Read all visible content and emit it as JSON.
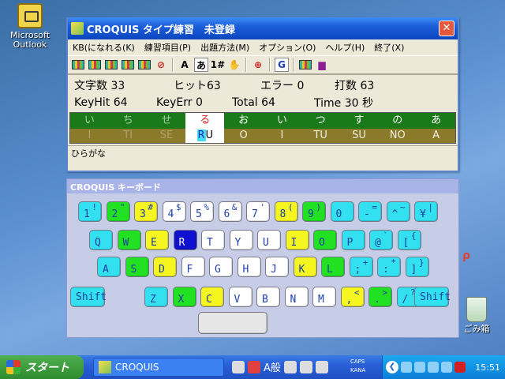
{
  "desktop": {
    "outlook_label": "Microsoft Outlook",
    "recycle_label": "ごみ箱",
    "side_glyph": "ρ"
  },
  "window": {
    "title": "CROQUIS タイプ練習　未登録",
    "close_glyph": "✕",
    "menu": [
      "KB(になれる(K)",
      "練習項目(P)",
      "出題方法(M)",
      "オプション(O)",
      "ヘルプ(H)",
      "終了(X)"
    ],
    "toolbar": {
      "a_label": "A",
      "kana_label": "あ",
      "num_label": "1#",
      "g_label": "G"
    },
    "stats": {
      "chars": "文字数 33",
      "hits": "ヒット63",
      "errors": "エラー 0",
      "strokes": "打数 63",
      "keyhit": "KeyHit 64",
      "keyerr": "KeyErr 0",
      "total": "Total 64",
      "time": "Time 30 秒"
    },
    "lane_kana": [
      "い",
      "ち",
      "せ",
      "る",
      "お",
      "い",
      "つ",
      "す",
      "の",
      "あ"
    ],
    "lane_roman": [
      "I",
      "TI",
      "SE",
      "RU",
      "O",
      "I",
      "TU",
      "SU",
      "NO",
      "A"
    ],
    "lane_cursor": 3,
    "status_text": "ひらがな"
  },
  "keyboard": {
    "title": "CROQUIS キーボード",
    "rows": [
      [
        [
          "1",
          "!",
          "c"
        ],
        [
          "2",
          "\"",
          "g"
        ],
        [
          "3",
          "#",
          "y"
        ],
        [
          "4",
          "$",
          "w"
        ],
        [
          "5",
          "%",
          "w"
        ],
        [
          "6",
          "&",
          "w"
        ],
        [
          "7",
          "'",
          "w"
        ],
        [
          "8",
          "(",
          "y"
        ],
        [
          "9",
          ")",
          "g"
        ],
        [
          "0",
          "",
          "c"
        ],
        [
          "-",
          "=",
          "c"
        ],
        [
          "^",
          "~",
          "c"
        ],
        [
          "¥",
          "|",
          "c"
        ]
      ],
      [
        [
          "Q",
          "",
          "c"
        ],
        [
          "W",
          "",
          "g"
        ],
        [
          "E",
          "",
          "y"
        ],
        [
          "R",
          "",
          "b"
        ],
        [
          "T",
          "",
          "w"
        ],
        [
          "Y",
          "",
          "w"
        ],
        [
          "U",
          "",
          "w"
        ],
        [
          "I",
          "",
          "y"
        ],
        [
          "O",
          "",
          "g"
        ],
        [
          "P",
          "",
          "c"
        ],
        [
          "@",
          "`",
          "c"
        ],
        [
          "[",
          "{",
          "c"
        ]
      ],
      [
        [
          "A",
          "",
          "c"
        ],
        [
          "S",
          "",
          "g"
        ],
        [
          "D",
          "",
          "y"
        ],
        [
          "F",
          "",
          "w"
        ],
        [
          "G",
          "",
          "w"
        ],
        [
          "H",
          "",
          "w"
        ],
        [
          "J",
          "",
          "w"
        ],
        [
          "K",
          "",
          "y"
        ],
        [
          "L",
          "",
          "g"
        ],
        [
          ";",
          "+",
          "c"
        ],
        [
          ":",
          "*",
          "c"
        ],
        [
          "]",
          "}",
          "c"
        ]
      ],
      [
        [
          "Z",
          "",
          "c"
        ],
        [
          "X",
          "",
          "g"
        ],
        [
          "C",
          "",
          "y"
        ],
        [
          "V",
          "",
          "w"
        ],
        [
          "B",
          "",
          "w"
        ],
        [
          "N",
          "",
          "w"
        ],
        [
          "M",
          "",
          "w"
        ],
        [
          ",",
          "<",
          "y"
        ],
        [
          ".",
          ">",
          "g"
        ],
        [
          "/",
          "?",
          "c"
        ],
        [
          "\\",
          "_",
          "c"
        ]
      ]
    ],
    "shift_left": "Shift",
    "shift_right": "Shift"
  },
  "taskbar": {
    "start_label": "スタート",
    "task_label": "CROQUIS",
    "ime_text": "A般",
    "caps": "CAPS",
    "kana": "KANA",
    "clock": "15:51"
  }
}
